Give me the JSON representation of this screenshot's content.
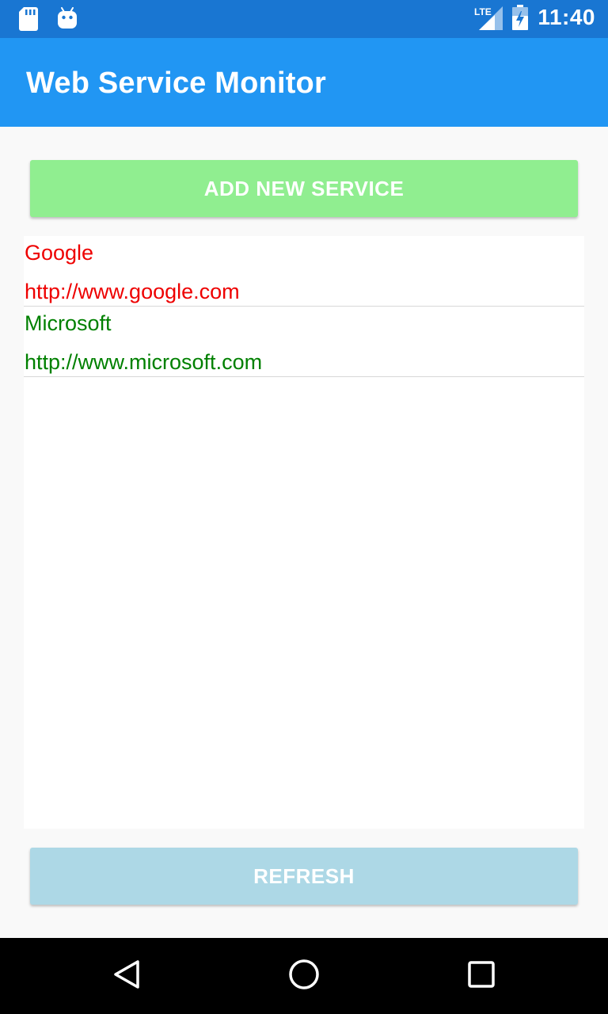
{
  "status_bar": {
    "time": "11:40",
    "network": "LTE",
    "background_color": "#1976d2",
    "icons": [
      "sd-card-icon",
      "android-icon",
      "lte-signal-icon",
      "battery-icon"
    ]
  },
  "app_bar": {
    "title": "Web Service Monitor",
    "background_color": "#2196f3"
  },
  "add_button": {
    "label": "ADD NEW SERVICE",
    "background_color": "#90ee90"
  },
  "services": [
    {
      "name": "Google",
      "url": "http://www.google.com",
      "color": "#ee0000"
    },
    {
      "name": "Microsoft",
      "url": "http://www.microsoft.com",
      "color": "#008000"
    }
  ],
  "refresh_button": {
    "label": "REFRESH",
    "background_color": "#add8e6"
  },
  "nav_bar": {
    "icons": [
      "back-icon",
      "home-icon",
      "recents-icon"
    ]
  }
}
